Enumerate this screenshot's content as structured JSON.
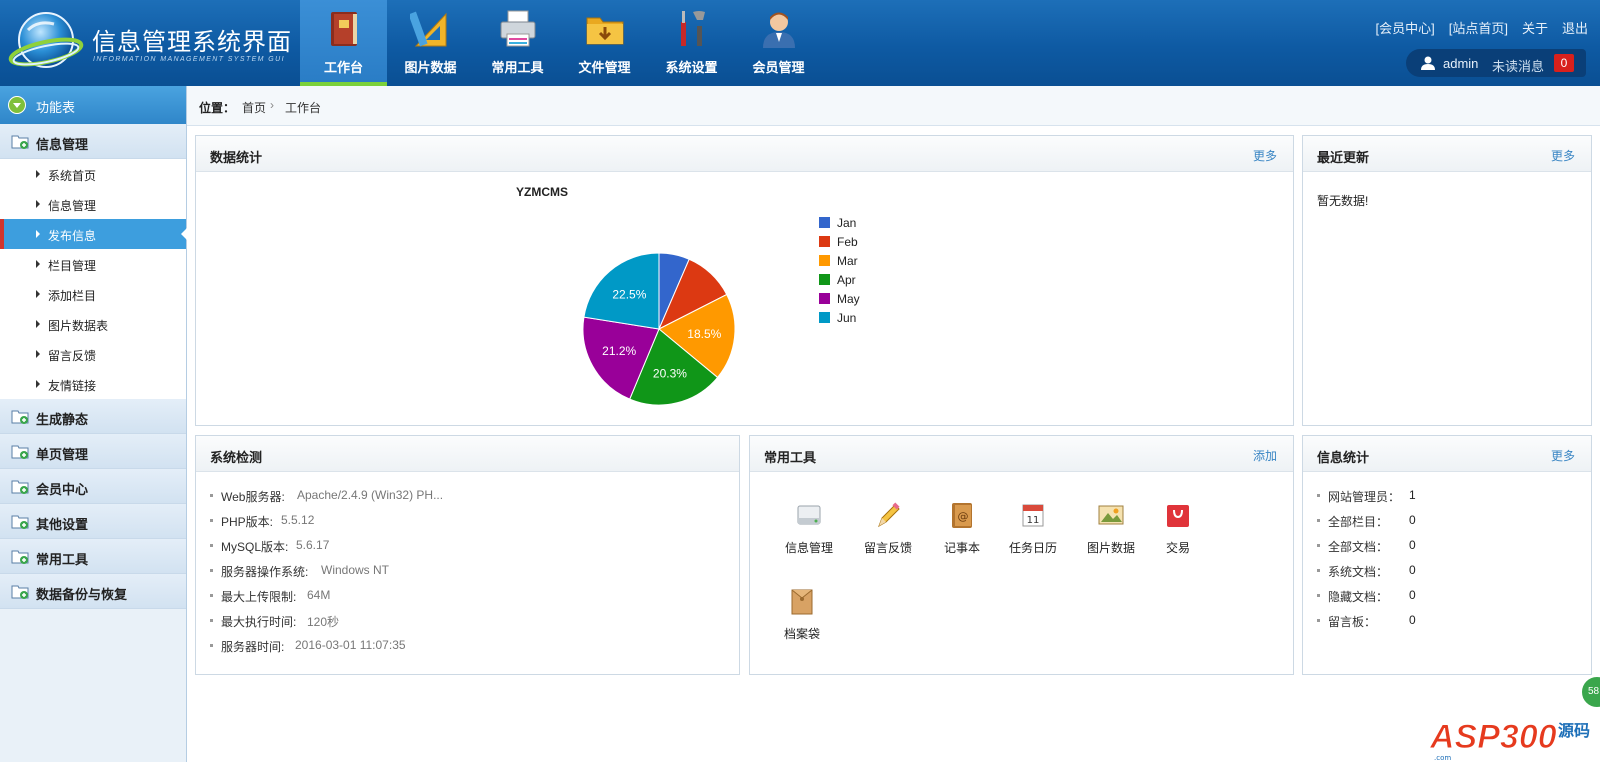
{
  "header": {
    "title": "信息管理系统界面",
    "subtitle": "INFORMATION MANAGEMENT SYSTEM GUI",
    "nav": [
      {
        "label": "工作台",
        "icon": "book-icon"
      },
      {
        "label": "图片数据",
        "icon": "ruler-triangle-icon"
      },
      {
        "label": "常用工具",
        "icon": "printer-icon"
      },
      {
        "label": "文件管理",
        "icon": "folder-icon"
      },
      {
        "label": "系统设置",
        "icon": "tools-icon"
      },
      {
        "label": "会员管理",
        "icon": "user-icon"
      }
    ],
    "top_links": [
      "[会员中心]",
      "[站点首页]",
      "关于",
      "退出"
    ],
    "user": {
      "name": "admin",
      "unread_label": "未读消息",
      "unread_count": "0"
    }
  },
  "sidebar": {
    "header": "功能表",
    "groups": [
      {
        "label": "信息管理",
        "items": [
          "系统首页",
          "信息管理",
          "发布信息",
          "栏目管理",
          "添加栏目",
          "图片数据表",
          "留言反馈",
          "友情链接"
        ],
        "active_index": 2
      },
      {
        "label": "生成静态"
      },
      {
        "label": "单页管理"
      },
      {
        "label": "会员中心"
      },
      {
        "label": "其他设置"
      },
      {
        "label": "常用工具"
      },
      {
        "label": "数据备份与恢复"
      }
    ]
  },
  "breadcrumb": {
    "label": "位置：",
    "home": "首页",
    "separator": "›",
    "current": "工作台"
  },
  "panels": {
    "stats": {
      "title": "数据统计",
      "more": "更多"
    },
    "recent": {
      "title": "最近更新",
      "more": "更多",
      "empty": "暂无数据!"
    },
    "system": {
      "title": "系统检测",
      "rows": [
        {
          "k": "Web服务器:",
          "v": "Apache/2.4.9 (Win32) PH..."
        },
        {
          "k": "PHP版本:",
          "v": "5.5.12"
        },
        {
          "k": "MySQL版本:",
          "v": "5.6.17"
        },
        {
          "k": "服务器操作系统:",
          "v": "Windows NT"
        },
        {
          "k": "最大上传限制:",
          "v": "64M"
        },
        {
          "k": "最大执行时间:",
          "v": "120秒"
        },
        {
          "k": "服务器时间:",
          "v": "2016-03-01 11:07:35"
        }
      ]
    },
    "tools": {
      "title": "常用工具",
      "more": "添加",
      "items": [
        "信息管理",
        "留言反馈",
        "记事本",
        "任务日历",
        "图片数据",
        "交易",
        "档案袋"
      ]
    },
    "info": {
      "title": "信息统计",
      "more": "更多",
      "rows": [
        {
          "k": "网站管理员：",
          "v": "1"
        },
        {
          "k": "全部栏目：",
          "v": "0"
        },
        {
          "k": "全部文档：",
          "v": "0"
        },
        {
          "k": "系统文档：",
          "v": "0"
        },
        {
          "k": "隐藏文档：",
          "v": "0"
        },
        {
          "k": "留言板：",
          "v": "0"
        }
      ]
    }
  },
  "chart_data": {
    "type": "pie",
    "title": "YZMCMS",
    "categories": [
      "Jan",
      "Feb",
      "Mar",
      "Apr",
      "May",
      "Jun"
    ],
    "values": [
      6.5,
      11.0,
      18.5,
      20.3,
      21.2,
      22.5
    ],
    "data_labels": [
      "",
      "",
      "18.5%",
      "20.3%",
      "21.2%",
      "22.5%"
    ],
    "colors": [
      "#3366cc",
      "#dc3912",
      "#ff9900",
      "#109618",
      "#990099",
      "#0099c6"
    ],
    "legend": "right"
  },
  "watermark": {
    "text": "ASP300源码",
    "badge": "58"
  }
}
